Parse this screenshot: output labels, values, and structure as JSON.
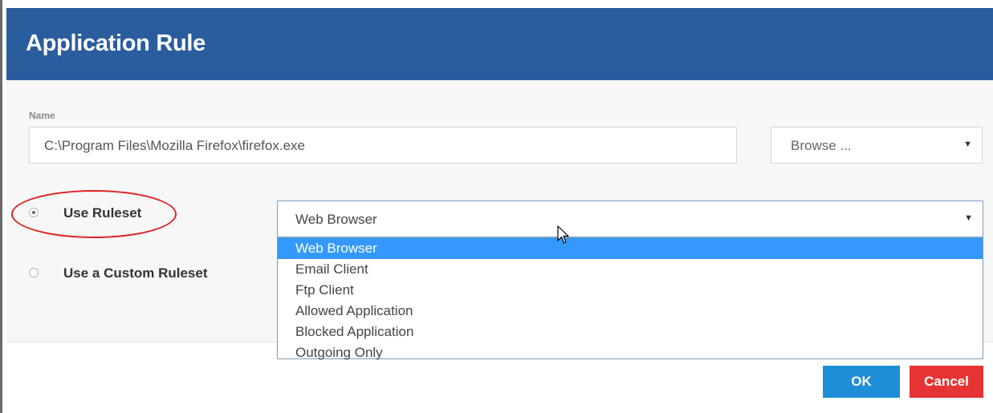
{
  "dialog": {
    "title": "Application Rule"
  },
  "name_field": {
    "label": "Name",
    "value": "C:\\Program Files\\Mozilla Firefox\\firefox.exe"
  },
  "browse": {
    "label": "Browse ...",
    "caret": "▼"
  },
  "use_ruleset": {
    "label": "Use Ruleset",
    "checked": true
  },
  "use_custom_ruleset": {
    "label": "Use a Custom Ruleset",
    "checked": false
  },
  "ruleset_select": {
    "value": "Web Browser",
    "caret": "▼",
    "options": [
      "Web Browser",
      "Email Client",
      "Ftp Client",
      "Allowed Application",
      "Blocked Application",
      "Outgoing Only"
    ],
    "highlighted_index": 0
  },
  "buttons": {
    "ok": "OK",
    "cancel": "Cancel"
  },
  "colors": {
    "header": "#2a5d9e",
    "ok": "#1e8fd6",
    "cancel": "#e63434",
    "highlight_ring": "#e02020",
    "option_selected": "#3399ff"
  }
}
